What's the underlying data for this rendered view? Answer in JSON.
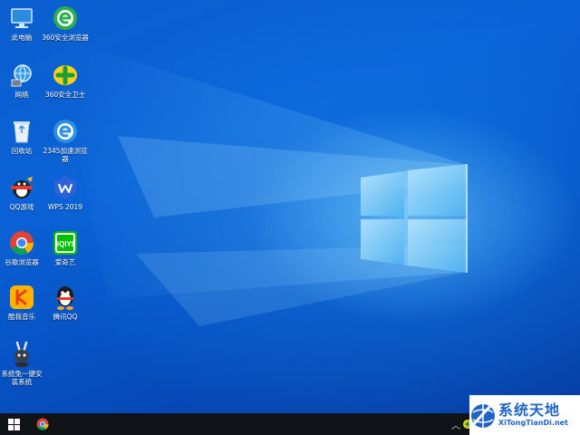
{
  "desktop": {
    "icons": [
      {
        "label": "此电脑",
        "icon": "computer-icon"
      },
      {
        "label": "360安全浏览器",
        "icon": "360-browser-icon"
      },
      {
        "label": "网络",
        "icon": "network-icon"
      },
      {
        "label": "360安全卫士",
        "icon": "360-guard-icon"
      },
      {
        "label": "回收站",
        "icon": "recycle-bin-icon"
      },
      {
        "label": "2345加速浏览器",
        "icon": "2345-browser-icon"
      },
      {
        "label": "QQ游戏",
        "icon": "qq-game-icon"
      },
      {
        "label": "WPS 2019",
        "icon": "wps-icon"
      },
      {
        "label": "谷歌浏览器",
        "icon": "chrome-icon"
      },
      {
        "label": "爱奇艺",
        "icon": "iqiyi-icon"
      },
      {
        "label": "酷我音乐",
        "icon": "kuwo-icon"
      },
      {
        "label": "腾讯QQ",
        "icon": "qq-icon"
      },
      {
        "label": "系统兔一键安装系统",
        "icon": "rabbit-installer-icon"
      }
    ]
  },
  "taskbar": {
    "start": "windows-start-icon",
    "pinned": [
      "chrome-icon"
    ],
    "tray": [
      "chevron-up-icon",
      "tray-app-icon"
    ]
  },
  "watermark": {
    "title": "系统天地",
    "url": "XiTongTianDi.net"
  },
  "colors": {
    "desktop_base": "#0a62d6",
    "taskbar": "#101418",
    "watermark_blue": "#1f64c4"
  }
}
